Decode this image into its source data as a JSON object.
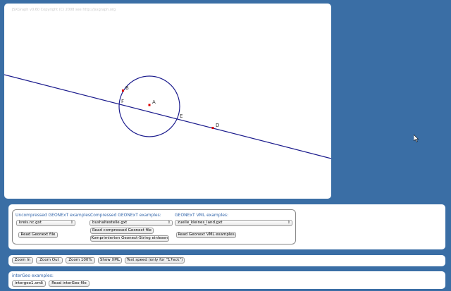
{
  "board": {
    "copyright": "JSXGraph v0.60 Copyright (C) 2008 see http://jsxgraph.org",
    "points": [
      "A",
      "B",
      "D",
      "E",
      "F"
    ]
  },
  "examples": {
    "uncompressed_title": "Uncompressed GEONExT examples:",
    "uncompressed_select": "kreis.nc.gxt",
    "uncompressed_button": "Read Geonext file",
    "compressed_title": "Compressed GEONExT examples:",
    "compressed_select": "bushaltestelle.gxt",
    "compressed_button": "Read compressed Geonext file",
    "compressed_string_button": "Komprimierten Geonext-String einlesen",
    "vml_title": "GEONExT VML examples:",
    "vml_select": "zuelle_kleines_land.gxt",
    "vml_button": "Read Geonext VML examples"
  },
  "toolbar": {
    "zoom_in": "Zoom In",
    "zoom_out": "Zoom Out",
    "zoom_100": "Zoom 100%",
    "show_xml": "Show XML",
    "test_speed": "Test speed (only for \"17eck\")"
  },
  "intergeo": {
    "title": "interGeo examples:",
    "select": "intergeo1.xml",
    "button": "Read interGeo file"
  },
  "colors": {
    "background": "#3a6ea5",
    "line": "#1a1a8c",
    "point": "#dd0000",
    "legend": "#3366aa"
  }
}
